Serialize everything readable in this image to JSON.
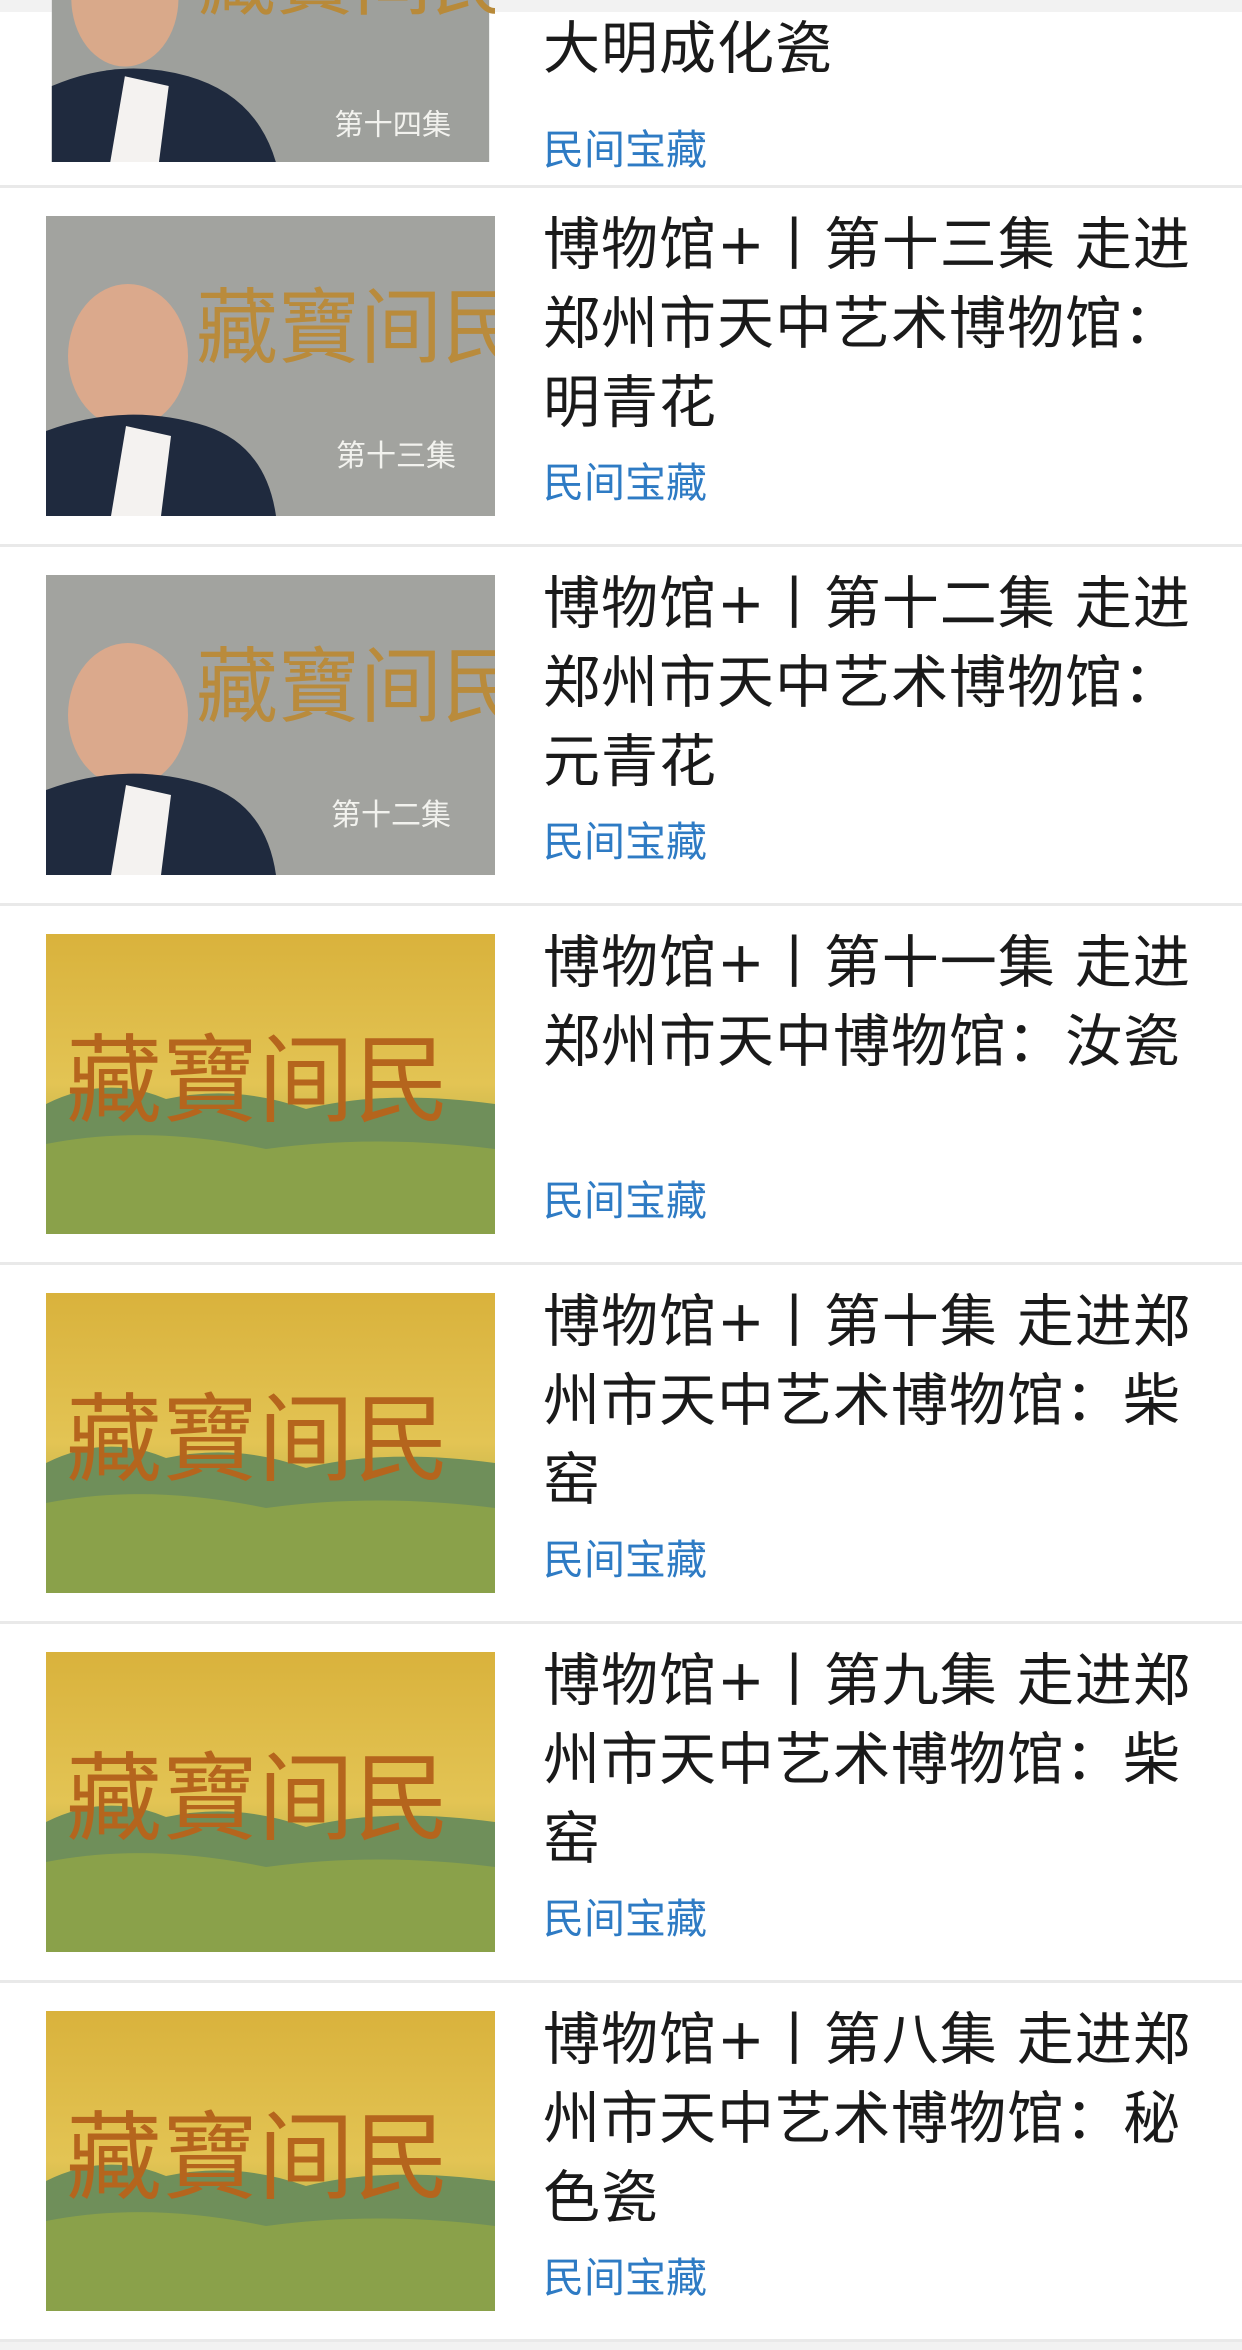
{
  "items": [
    {
      "title": "大明成化瓷",
      "source": "民间宝藏",
      "thumb": "host",
      "episode_caption": "第十四集"
    },
    {
      "title": "博物馆+丨第十三集 走进郑州市天中艺术博物馆：明青花",
      "source": "民间宝藏",
      "thumb": "host",
      "episode_caption": "第十三集"
    },
    {
      "title": "博物馆+丨第十二集 走进郑州市天中艺术博物馆：元青花",
      "source": "民间宝藏",
      "thumb": "host",
      "episode_caption": "第十二集"
    },
    {
      "title": "博物馆+丨第十一集 走进郑州市天中博物馆：汝瓷",
      "source": "民间宝藏",
      "thumb": "landscape",
      "episode_caption": ""
    },
    {
      "title": "博物馆+丨第十集 走进郑州市天中艺术博物馆：柴窑",
      "source": "民间宝藏",
      "thumb": "landscape",
      "episode_caption": ""
    },
    {
      "title": "博物馆+丨第九集 走进郑州市天中艺术博物馆：柴窑",
      "source": "民间宝藏",
      "thumb": "landscape",
      "episode_caption": ""
    },
    {
      "title": "博物馆+丨第八集 走进郑州市天中艺术博物馆：秘色瓷",
      "source": "民间宝藏",
      "thumb": "landscape",
      "episode_caption": ""
    }
  ],
  "thumb_logo_text": "藏寶间民",
  "colors": {
    "link": "#2e7bc4",
    "title": "#1a1a1a",
    "divider": "#e9e9e9"
  }
}
